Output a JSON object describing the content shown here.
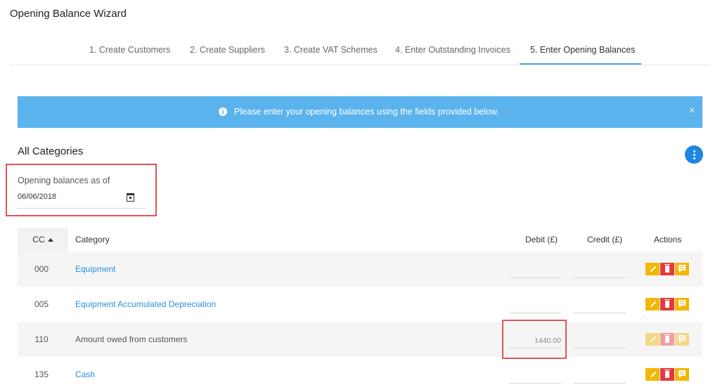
{
  "page": {
    "title": "Opening Balance Wizard"
  },
  "tabs": [
    {
      "label": "1. Create Customers"
    },
    {
      "label": "2. Create Suppliers"
    },
    {
      "label": "3. Create VAT Schemes"
    },
    {
      "label": "4. Enter Outstanding Invoices"
    },
    {
      "label": "5. Enter Opening Balances",
      "active": true
    }
  ],
  "alert": {
    "icon": "info-circle-icon",
    "message": "Please enter your opening balances using the fields provided below.",
    "close": "×",
    "color": "#5ab3ec"
  },
  "section": {
    "title": "All Categories",
    "menu_icon": "more-vertical-icon"
  },
  "date": {
    "label": "Opening balances as of",
    "value": "06/06/2018",
    "icon": "calendar-icon"
  },
  "table": {
    "columns": {
      "cc": "CC",
      "category": "Category",
      "debit": "Debit (£)",
      "credit": "Credit (£)",
      "actions": "Actions"
    },
    "sort": {
      "column": "CC",
      "direction": "ascending"
    },
    "rows": [
      {
        "cc": "000",
        "category": "Equipment",
        "debit": "",
        "credit": "",
        "link": true
      },
      {
        "cc": "005",
        "category": "Equipment Accumulated Depreciation",
        "debit": "",
        "credit": "",
        "link": true
      },
      {
        "cc": "110",
        "category": "Amount owed from customers",
        "debit": "1440.00",
        "credit": "",
        "link": false
      },
      {
        "cc": "135",
        "category": "Cash",
        "debit": "",
        "credit": "",
        "link": true
      }
    ]
  },
  "colors": {
    "accent": "#2b8fe0",
    "edit": "#f2b705",
    "delete": "#e8383d",
    "highlight": "#e05555"
  }
}
